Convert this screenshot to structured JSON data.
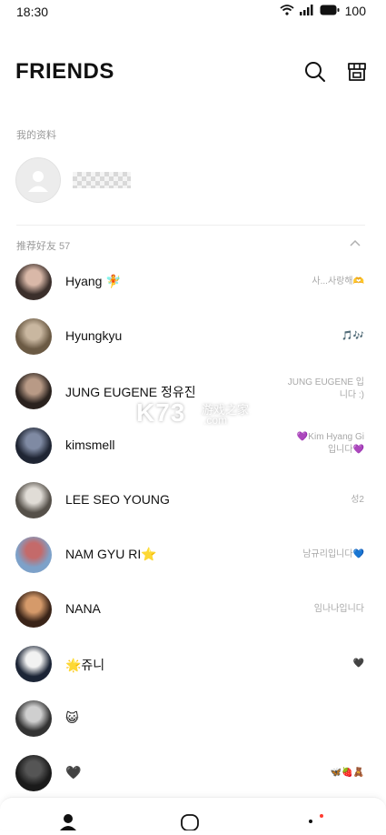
{
  "status_bar": {
    "time": "18:30",
    "wifi_icon": "wifi-icon",
    "signal_icon": "signal-icon",
    "battery_icon": "battery-icon",
    "battery": "100"
  },
  "header": {
    "title": "FRIENDS",
    "search_icon": "search-icon",
    "shop_icon": "shop-icon"
  },
  "my_profile": {
    "section_label": "我的资料",
    "avatar_icon": "default-avatar-icon"
  },
  "recommended": {
    "section_label": "推荐好友 57",
    "collapse_icon": "chevron-up-icon"
  },
  "friends": [
    {
      "name": "Hyang 🧚",
      "status": "사...사랑해🫶",
      "avatar_colors": [
        "#3b2f2b",
        "#d9b8a8"
      ]
    },
    {
      "name": "Hyungkyu",
      "status": "🎵🎶",
      "avatar_colors": [
        "#6b5a44",
        "#c9b7a0"
      ]
    },
    {
      "name": "JUNG EUGENE 정유진",
      "status": "JUNG EUGENE 입\n니다 :)",
      "avatar_colors": [
        "#2a221e",
        "#b89a86"
      ]
    },
    {
      "name": "kimsmell",
      "status": "💜Kim Hyang Gi\n입니다💜",
      "avatar_colors": [
        "#1f2533",
        "#7f8aa3"
      ]
    },
    {
      "name": "LEE SEO YOUNG",
      "status": "성2",
      "avatar_colors": [
        "#555049",
        "#e0dcd6"
      ]
    },
    {
      "name": "NAM GYU RI⭐",
      "status": "남규리입니다💙",
      "avatar_colors": [
        "#7da1c9",
        "#c46a6a"
      ]
    },
    {
      "name": "NANA",
      "status": "임나나입니다",
      "avatar_colors": [
        "#3a2418",
        "#d59a6a"
      ]
    },
    {
      "name": "🌟쥬니",
      "status": "🖤",
      "avatar_colors": [
        "#1c2536",
        "#f2f2f2"
      ]
    },
    {
      "name": "😺",
      "status": "",
      "avatar_colors": [
        "#333333",
        "#cfcfcf"
      ]
    },
    {
      "name": "🖤",
      "status": "🦋🍓🧸",
      "avatar_colors": [
        "#1a1a1a",
        "#555555"
      ]
    }
  ],
  "watermark": {
    "big": "K73",
    "small": "游戏之家",
    "domain": ".com"
  },
  "bottom_nav": {
    "friends_icon": "person-icon",
    "chats_icon": "chat-bubble-icon",
    "more_icon": "more-dots-icon",
    "accent": "#ff3b30"
  }
}
